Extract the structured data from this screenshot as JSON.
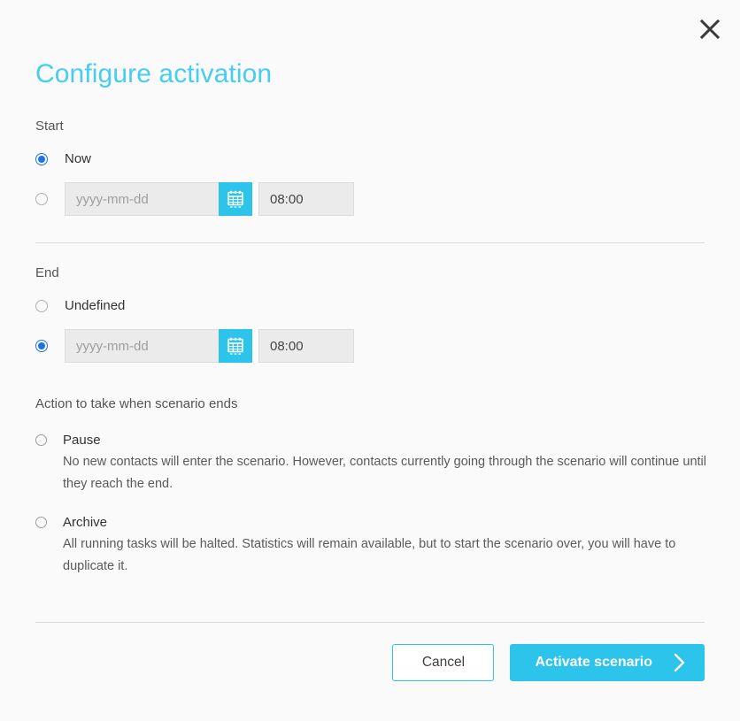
{
  "dialog": {
    "title": "Configure activation",
    "close_icon": "close-icon"
  },
  "start": {
    "label": "Start",
    "options": [
      {
        "label": "Now",
        "selected": true
      },
      {
        "label": "",
        "selected": false
      }
    ],
    "date_placeholder": "yyyy-mm-dd",
    "date_value": "",
    "time_value": "08:00",
    "calendar_icon": "calendar-icon"
  },
  "end": {
    "label": "End",
    "options": [
      {
        "label": "Undefined",
        "selected": false
      },
      {
        "label": "",
        "selected": true
      }
    ],
    "date_placeholder": "yyyy-mm-dd",
    "date_value": "",
    "time_value": "08:00",
    "calendar_icon": "calendar-icon"
  },
  "action": {
    "label": "Action to take when scenario ends",
    "options": [
      {
        "title": "Pause",
        "selected": false,
        "description": "No new contacts will enter the scenario. However, contacts currently going through the scenario will continue until they reach the end."
      },
      {
        "title": "Archive",
        "selected": false,
        "description": "All running tasks will be halted. Statistics will remain available, but to start the scenario over, you will have to duplicate it."
      }
    ]
  },
  "footer": {
    "cancel_label": "Cancel",
    "activate_label": "Activate scenario",
    "arrow_icon": "chevron-right-icon"
  },
  "colors": {
    "accent": "#2cc4ea",
    "title": "#46cdef",
    "radio_selected": "#1a73e8",
    "background": "#fafafa",
    "field_background": "#ebebeb"
  }
}
